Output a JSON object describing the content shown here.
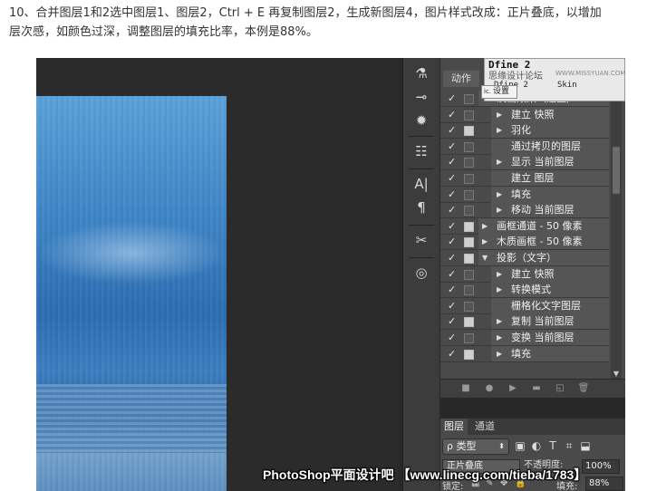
{
  "article": {
    "line1": "10、合并图层1和2选中图层1、图层2，Ctrl + E 再复制图层2，生成新图层4，图片样式改成：正片叠底，以增加",
    "line2": "层次感，如颜色过深，调整图层的填充比率，本例是88%。"
  },
  "panel_tab": "动作",
  "dfine": {
    "title": "Dfine 2",
    "subtitle": "思缘设计论坛",
    "watermark": "WWW.MISSYUAN.COM",
    "col1": "Dfine 2",
    "col2": "Skin"
  },
  "settings_popup": "设置",
  "actions": [
    {
      "check": "✓",
      "dialog": false,
      "arrow": "▼",
      "indent": 0,
      "label": "淡出效果（选区）"
    },
    {
      "check": "✓",
      "dialog": false,
      "arrow": "▶",
      "indent": 1,
      "label": "建立 快照"
    },
    {
      "check": "✓",
      "dialog": true,
      "arrow": "▶",
      "indent": 1,
      "label": "羽化"
    },
    {
      "check": "✓",
      "dialog": false,
      "arrow": "",
      "indent": 1,
      "label": "通过拷贝的图层"
    },
    {
      "check": "✓",
      "dialog": false,
      "arrow": "▶",
      "indent": 1,
      "label": "显示 当前图层"
    },
    {
      "check": "✓",
      "dialog": false,
      "arrow": "",
      "indent": 1,
      "label": "建立 图层"
    },
    {
      "check": "✓",
      "dialog": false,
      "arrow": "▶",
      "indent": 1,
      "label": "填充"
    },
    {
      "check": "✓",
      "dialog": false,
      "arrow": "▶",
      "indent": 1,
      "label": "移动 当前图层"
    },
    {
      "check": "✓",
      "dialog": true,
      "arrow": "▶",
      "indent": 0,
      "label": "画框通道 - 50 像素"
    },
    {
      "check": "✓",
      "dialog": true,
      "arrow": "▶",
      "indent": 0,
      "label": "木质画框 - 50 像素"
    },
    {
      "check": "✓",
      "dialog": true,
      "arrow": "▼",
      "indent": 0,
      "label": "投影（文字）"
    },
    {
      "check": "✓",
      "dialog": false,
      "arrow": "▶",
      "indent": 1,
      "label": "建立 快照"
    },
    {
      "check": "✓",
      "dialog": false,
      "arrow": "▶",
      "indent": 1,
      "label": "转换模式"
    },
    {
      "check": "✓",
      "dialog": false,
      "arrow": "",
      "indent": 1,
      "label": "栅格化文字图层"
    },
    {
      "check": "✓",
      "dialog": true,
      "arrow": "▶",
      "indent": 1,
      "label": "复制 当前图层"
    },
    {
      "check": "✓",
      "dialog": false,
      "arrow": "▶",
      "indent": 1,
      "label": "变换 当前图层"
    },
    {
      "check": "✓",
      "dialog": true,
      "arrow": "▶",
      "indent": 1,
      "label": "填充"
    }
  ],
  "tools": [
    "⚗",
    "⊸",
    "✹",
    "☷",
    "A|",
    "¶",
    "✂",
    "◎"
  ],
  "footer_icons": [
    "■",
    "●",
    "▶",
    "▬",
    "◱",
    "🗑"
  ],
  "layers": {
    "tab_layers": "图层",
    "tab_channels": "通道",
    "kind": "ρ 类型",
    "blend_mode": "正片叠底",
    "opacity_label": "不透明度:",
    "opacity_value": "100%",
    "lock_label": "锁定:",
    "fill_label": "填充:",
    "fill_value": "88%"
  },
  "watermark": "PhotoShop平面设计吧 【www.linecg.com/tieba/1783】",
  "colors": {
    "panel_bg": "#4a4a4a",
    "canvas_blue": "#3f86c6"
  }
}
